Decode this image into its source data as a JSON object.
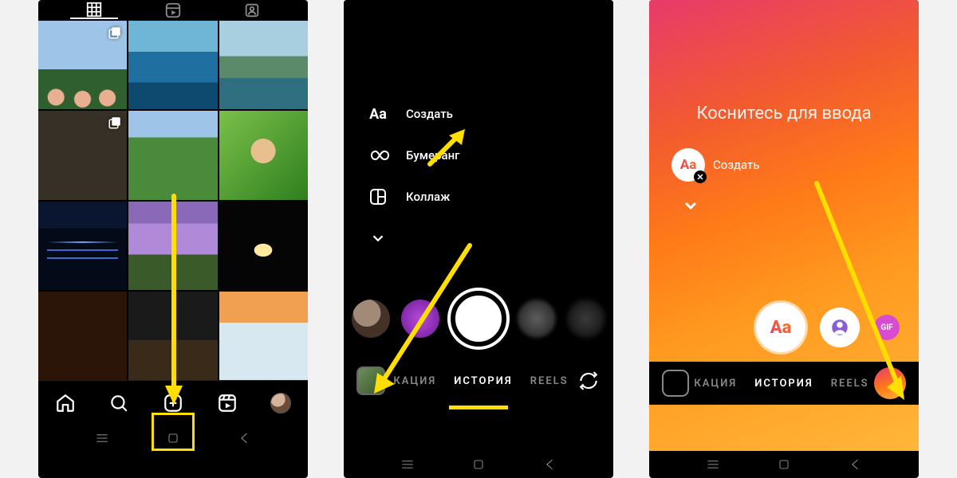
{
  "phone1": {
    "top_tabs": {
      "grid": "grid-icon",
      "reels": "reels-icon",
      "tagged": "tagged-icon"
    },
    "nav": {
      "home": "home",
      "search": "search",
      "create": "create",
      "reels": "reels",
      "profile": "profile"
    }
  },
  "phone2": {
    "modes": {
      "create": "Создать",
      "boomerang": "Бумеранг",
      "collage": "Коллаж"
    },
    "tabs": {
      "left": "КАЦИЯ",
      "center": "ИСТОРИЯ",
      "right": "REELS"
    }
  },
  "phone3": {
    "hint": "Коснитесь для ввода",
    "chip_label": "Создать",
    "gif_label": "GIF",
    "tabs": {
      "left": "КАЦИЯ",
      "center": "ИСТОРИЯ",
      "right": "REELS"
    }
  },
  "colors": {
    "highlight": "#ffde00"
  }
}
